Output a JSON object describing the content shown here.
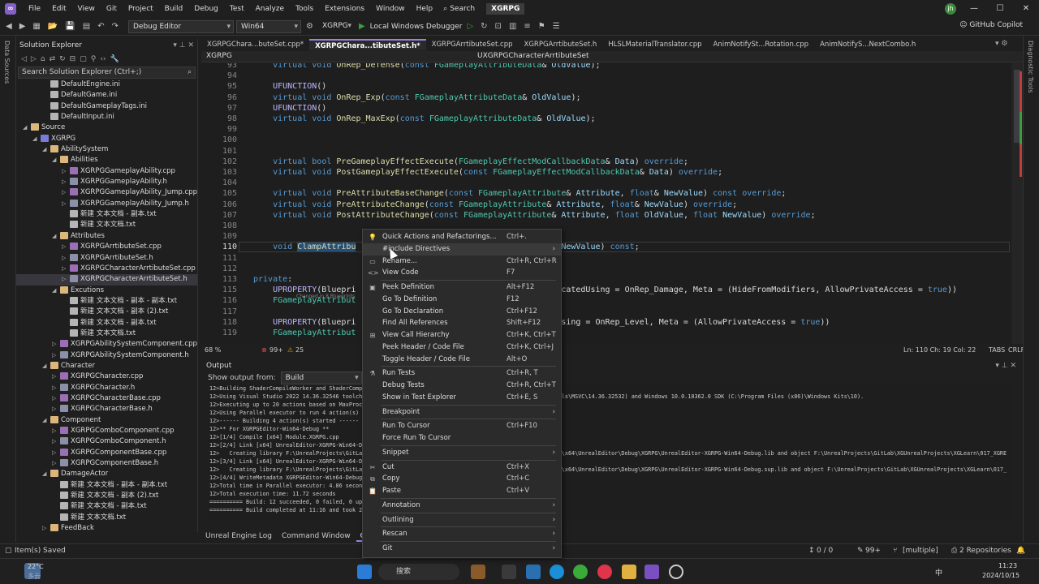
{
  "menu": [
    "File",
    "Edit",
    "View",
    "Git",
    "Project",
    "Build",
    "Debug",
    "Test",
    "Analyze",
    "Tools",
    "Extensions",
    "Window",
    "Help"
  ],
  "search_label": "Search",
  "solution_name": "XGRPG",
  "avatar_text": "jh",
  "window_controls": [
    "—",
    "☐",
    "✕"
  ],
  "toolbar": {
    "config": "Debug Editor",
    "platform": "Win64",
    "startup": "XGRPG",
    "debugger": "Local Windows Debugger",
    "copilot": "GitHub Copilot"
  },
  "left_strip": [
    "Data Sources"
  ],
  "right_strip": [
    "Diagnostic Tools"
  ],
  "solution_explorer": {
    "title": "Solution Explorer",
    "search_placeholder": "Search Solution Explorer (Ctrl+;)",
    "items": [
      {
        "label": "DefaultEngine.ini",
        "indent": 3,
        "type": "ini",
        "exp": ""
      },
      {
        "label": "DefaultGame.ini",
        "indent": 3,
        "type": "ini",
        "exp": ""
      },
      {
        "label": "DefaultGameplayTags.ini",
        "indent": 3,
        "type": "ini",
        "exp": ""
      },
      {
        "label": "DefaultInput.ini",
        "indent": 3,
        "type": "ini",
        "exp": ""
      },
      {
        "label": "Source",
        "indent": 1,
        "type": "folder",
        "exp": "◢"
      },
      {
        "label": "XGRPG",
        "indent": 2,
        "type": "proj",
        "exp": "◢"
      },
      {
        "label": "AbilitySystem",
        "indent": 3,
        "type": "folder",
        "exp": "◢"
      },
      {
        "label": "Abilities",
        "indent": 4,
        "type": "folder",
        "exp": "◢"
      },
      {
        "label": "XGRPGGameplayAbility.cpp",
        "indent": 5,
        "type": "cpp",
        "exp": "▷"
      },
      {
        "label": "XGRPGGameplayAbility.h",
        "indent": 5,
        "type": "h",
        "exp": "▷"
      },
      {
        "label": "XGRPGGameplayAbility_Jump.cpp",
        "indent": 5,
        "type": "cpp",
        "exp": "▷"
      },
      {
        "label": "XGRPGGameplayAbility_Jump.h",
        "indent": 5,
        "type": "h",
        "exp": "▷"
      },
      {
        "label": "新建 文本文档 - 副本.txt",
        "indent": 5,
        "type": "txt",
        "exp": ""
      },
      {
        "label": "新建 文本文档.txt",
        "indent": 5,
        "type": "txt",
        "exp": ""
      },
      {
        "label": "Attributes",
        "indent": 4,
        "type": "folder",
        "exp": "◢"
      },
      {
        "label": "XGRPGArrtibuteSet.cpp",
        "indent": 5,
        "type": "cpp",
        "exp": "▷"
      },
      {
        "label": "XGRPGArrtibuteSet.h",
        "indent": 5,
        "type": "h",
        "exp": "▷"
      },
      {
        "label": "XGRPGCharacterArrtibuteSet.cpp",
        "indent": 5,
        "type": "cpp",
        "exp": "▷"
      },
      {
        "label": "XGRPGCharacterArrtibuteSet.h",
        "indent": 5,
        "type": "h",
        "exp": "▷",
        "sel": true
      },
      {
        "label": "Excutions",
        "indent": 4,
        "type": "folder",
        "exp": "◢"
      },
      {
        "label": "新建 文本文档 - 副本 - 副本.txt",
        "indent": 5,
        "type": "txt",
        "exp": ""
      },
      {
        "label": "新建 文本文档 - 副本 (2).txt",
        "indent": 5,
        "type": "txt",
        "exp": ""
      },
      {
        "label": "新建 文本文档 - 副本.txt",
        "indent": 5,
        "type": "txt",
        "exp": ""
      },
      {
        "label": "新建 文本文档.txt",
        "indent": 5,
        "type": "txt",
        "exp": ""
      },
      {
        "label": "XGRPGAbilitySystemComponent.cpp",
        "indent": 4,
        "type": "cpp",
        "exp": "▷"
      },
      {
        "label": "XGRPGAbilitySystemComponent.h",
        "indent": 4,
        "type": "h",
        "exp": "▷"
      },
      {
        "label": "Character",
        "indent": 3,
        "type": "folder",
        "exp": "◢"
      },
      {
        "label": "XGRPGCharacter.cpp",
        "indent": 4,
        "type": "cpp",
        "exp": "▷"
      },
      {
        "label": "XGRPGCharacter.h",
        "indent": 4,
        "type": "h",
        "exp": "▷"
      },
      {
        "label": "XGRPGCharacterBase.cpp",
        "indent": 4,
        "type": "cpp",
        "exp": "▷"
      },
      {
        "label": "XGRPGCharacterBase.h",
        "indent": 4,
        "type": "h",
        "exp": "▷"
      },
      {
        "label": "Component",
        "indent": 3,
        "type": "folder",
        "exp": "◢"
      },
      {
        "label": "XGRPGComboComponent.cpp",
        "indent": 4,
        "type": "cpp",
        "exp": "▷"
      },
      {
        "label": "XGRPGComboComponent.h",
        "indent": 4,
        "type": "h",
        "exp": "▷"
      },
      {
        "label": "XGRPGComponentBase.cpp",
        "indent": 4,
        "type": "cpp",
        "exp": "▷"
      },
      {
        "label": "XGRPGComponentBase.h",
        "indent": 4,
        "type": "h",
        "exp": "▷"
      },
      {
        "label": "DamageActor",
        "indent": 3,
        "type": "folder",
        "exp": "◢"
      },
      {
        "label": "新建 文本文档 - 副本 - 副本.txt",
        "indent": 4,
        "type": "txt",
        "exp": ""
      },
      {
        "label": "新建 文本文档 - 副本 (2).txt",
        "indent": 4,
        "type": "txt",
        "exp": ""
      },
      {
        "label": "新建 文本文档 - 副本.txt",
        "indent": 4,
        "type": "txt",
        "exp": ""
      },
      {
        "label": "新建 文本文档.txt",
        "indent": 4,
        "type": "txt",
        "exp": ""
      },
      {
        "label": "FeedBack",
        "indent": 3,
        "type": "folder",
        "exp": "▷"
      }
    ]
  },
  "tabs": [
    {
      "label": "XGRPGChara...buteSet.cpp*",
      "active": false
    },
    {
      "label": "XGRPGChara...tibuteSet.h*",
      "active": true
    },
    {
      "label": "XGRPGArrtibuteSet.cpp",
      "active": false
    },
    {
      "label": "XGRPGArrtibuteSet.h",
      "active": false
    },
    {
      "label": "HLSLMaterialTranslator.cpp",
      "active": false
    },
    {
      "label": "AnimNotifySt...Rotation.cpp",
      "active": false
    },
    {
      "label": "AnimNotifyS...NextCombo.h",
      "active": false
    }
  ],
  "navbar": {
    "project": "XGRPG",
    "scope": "UXGRPGCharacterArrtibuteSet"
  },
  "code_lines": [
    {
      "n": "93",
      "html": "    <span class='kw'>virtual</span> <span class='kw'>void</span> <span class='fn'>OnRep_Defense</span>(<span class='kw'>const</span> <span class='ty'>FGameplayAttributeData</span>&amp; <span class='prm'>OldValue</span>);"
    },
    {
      "n": "94",
      "html": ""
    },
    {
      "n": "95",
      "html": "    <span class='mc'>UFUNCTION</span>()"
    },
    {
      "n": "96",
      "html": "    <span class='kw'>virtual</span> <span class='kw'>void</span> <span class='fn'>OnRep_Exp</span>(<span class='kw'>const</span> <span class='ty'>FGameplayAttributeData</span>&amp; <span class='prm'>OldValue</span>);"
    },
    {
      "n": "97",
      "html": "    <span class='mc'>UFUNCTION</span>()"
    },
    {
      "n": "98",
      "html": "    <span class='kw'>virtual</span> <span class='kw'>void</span> <span class='fn'>OnRep_MaxExp</span>(<span class='kw'>const</span> <span class='ty'>FGameplayAttributeData</span>&amp; <span class='prm'>OldValue</span>);"
    },
    {
      "n": "99",
      "html": ""
    },
    {
      "n": "100",
      "html": ""
    },
    {
      "n": "101",
      "html": ""
    },
    {
      "n": "102",
      "html": "    <span class='kw'>virtual</span> <span class='kw'>bool</span> <span class='fn'>PreGameplayEffectExecute</span>(<span class='ty'>FGameplayEffectModCallbackData</span>&amp; <span class='prm'>Data</span>) <span class='kw'>override</span>;"
    },
    {
      "n": "103",
      "html": "    <span class='kw'>virtual</span> <span class='kw'>void</span> <span class='fn'>PostGameplayEffectExecute</span>(<span class='kw'>const</span> <span class='ty'>FGameplayEffectModCallbackData</span>&amp; <span class='prm'>Data</span>) <span class='kw'>override</span>;"
    },
    {
      "n": "104",
      "html": ""
    },
    {
      "n": "105",
      "html": "    <span class='kw'>virtual</span> <span class='kw'>void</span> <span class='fn'>PreAttributeBaseChange</span>(<span class='kw'>const</span> <span class='ty'>FGameplayAttribute</span>&amp; <span class='prm'>Attribute</span>, <span class='kw'>float</span>&amp; <span class='prm'>NewValue</span>) <span class='kw'>const</span> <span class='kw'>override</span>;"
    },
    {
      "n": "106",
      "html": "    <span class='kw'>virtual</span> <span class='kw'>void</span> <span class='fn'>PreAttributeChange</span>(<span class='kw'>const</span> <span class='ty'>FGameplayAttribute</span>&amp; <span class='prm'>Attribute</span>, <span class='kw'>float</span>&amp; <span class='prm'>NewValue</span>) <span class='kw'>override</span>;"
    },
    {
      "n": "107",
      "html": "    <span class='kw'>virtual</span> <span class='kw'>void</span> <span class='fn'>PostAttributeChange</span>(<span class='kw'>const</span> <span class='ty'>FGameplayAttribute</span>&amp; <span class='prm'>Attribute</span>, <span class='kw'>float</span> <span class='prm'>OldValue</span>, <span class='kw'>float</span> <span class='prm'>NewValue</span>) <span class='kw'>override</span>;"
    },
    {
      "n": "108",
      "html": ""
    },
    {
      "n": "109",
      "html": ""
    },
    {
      "n": "110",
      "html": "    <span class='kw'>void</span> <span class='fn hl'>ClampAttribu</span>                                 , <span class='kw'>float</span>&amp; <span class='prm'>NewValue</span>) <span class='kw'>const</span>;",
      "cur": true
    },
    {
      "n": "111",
      "html": ""
    },
    {
      "n": "112",
      "html": ""
    },
    {
      "n": "113",
      "html": "<span class='kw'>private</span>:"
    },
    {
      "n": "115",
      "html": "    <span class='mc'>UPROPERTY</span>(Bluepri                                 <span class='str'>e\"</span>, ReplicatedUsing = OnRep_Damage, Meta = (HideFromModifiers, AllowPrivateAccess = <span class='kw'>true</span>))"
    },
    {
      "n": "116",
      "html": "    <span class='ty'>FGameplayAttribut</span>"
    },
    {
      "n": "117",
      "html": ""
    },
    {
      "n": "118",
      "html": "    <span class='mc'>UPROPERTY</span>(Bluepri                                 plicatedUsing = OnRep_Level, Meta = (AllowPrivateAccess = <span class='kw'>true</span>))"
    },
    {
      "n": "119",
      "html": "    <span class='ty'>FGameplayAttribut</span>"
    }
  ],
  "inline_hint": "Changed in 8 Blueprints",
  "editor_status": {
    "zoom": "68 %",
    "errors": "99+",
    "warnings": "25",
    "position": "Ln: 110   Ch: 19   Col: 22",
    "tabs": "TABS",
    "eol": "CRLF"
  },
  "output": {
    "title": "Output",
    "show_from_label": "Show output from:",
    "source": "Build",
    "lines": [
      "12>Building ShaderCompileWorker and ShaderCompileWorker",
      "12>Using Visual Studio 2022 14.36.32546 toolcha                                                      C\\Tools\\MSVC\\14.36.32532) and Windows 10.0.18362.0 SDK (C:\\Program Files (x86)\\Windows Kits\\10).",
      "12>Executing up to 20 actions based on MaxProce",
      "12>Using Parallel executor to run 4 action(s)",
      "12>------ Building 4 action(s) started ------",
      "12>** For XGRPGEditor-Win64-Debug **",
      "12>[1/4] Compile [x64] Module.XGRPG.cpp",
      "12>[2/4] Link [x64] UnrealEditor-XGRPG-Win64-De",
      "12>   Creating library F:\\UnrealProjects\\GitLab                                                      Win64\\x64\\UnrealEditor\\Debug\\XGRPG\\UnrealEditor-XGRPG-Win64-Debug.lib and object F:\\UnrealProjects\\GitLab\\XGUnrealProjects\\XGLearn\\017_XGRE",
      "12>[3/4] Link [x64] UnrealEditor-XGRPG-Win64-De",
      "12>   Creating library F:\\UnrealProjects\\GitLab                                                      Win64\\x64\\UnrealEditor\\Debug\\XGRPG\\UnrealEditor-XGRPG-Win64-Debug.sup.lib and object F:\\UnrealProjects\\GitLab\\XGUnrealProjects\\XGLearn\\017_",
      "12>[4/4] WriteMetadata XGRPGEditor-Win64-Debug.",
      "12>Total time in Parallel executor: 4.86 second",
      "12>Total execution time: 11.72 seconds",
      "========== Build: 12 succeeded, 0 failed, 0 up-",
      "========== Build completed at 11:16 and took 20"
    ]
  },
  "bottom_tabs": [
    {
      "label": "Unreal Engine Log",
      "active": false
    },
    {
      "label": "Command Window",
      "active": false
    },
    {
      "label": "Output",
      "active": true
    }
  ],
  "statusbar": {
    "left": "Item(s) Saved",
    "changes": "0 / 0",
    "errors": "99+",
    "branch": "[multiple]",
    "repos": "2 Repositories"
  },
  "taskbar": {
    "weather_temp": "22°C",
    "weather_desc": "多云",
    "search": "搜索",
    "lang": "中",
    "time": "11:23",
    "date": "2024/10/15"
  },
  "context_menu": [
    {
      "label": "Quick Actions and Refactorings...",
      "shortcut": "Ctrl+.",
      "icon": "💡"
    },
    {
      "label": "#include Directives",
      "shortcut": "",
      "arrow": true,
      "hot": true
    },
    {
      "label": "Rename...",
      "shortcut": "Ctrl+R, Ctrl+R",
      "icon": "▭"
    },
    {
      "label": "View Code",
      "shortcut": "F7",
      "icon": "<>"
    },
    {
      "sep": true
    },
    {
      "label": "Peek Definition",
      "shortcut": "Alt+F12",
      "icon": "▣"
    },
    {
      "label": "Go To Definition",
      "shortcut": "F12"
    },
    {
      "label": "Go To Declaration",
      "shortcut": "Ctrl+F12"
    },
    {
      "label": "Find All References",
      "shortcut": "Shift+F12"
    },
    {
      "label": "View Call Hierarchy",
      "shortcut": "Ctrl+K, Ctrl+T",
      "icon": "⊞"
    },
    {
      "label": "Peek Header / Code File",
      "shortcut": "Ctrl+K, Ctrl+J"
    },
    {
      "label": "Toggle Header / Code File",
      "shortcut": "Alt+O"
    },
    {
      "sep": true
    },
    {
      "label": "Run Tests",
      "shortcut": "Ctrl+R, T",
      "icon": "⚗"
    },
    {
      "label": "Debug Tests",
      "shortcut": "Ctrl+R, Ctrl+T"
    },
    {
      "label": "Show in Test Explorer",
      "shortcut": "Ctrl+E, S"
    },
    {
      "sep": true
    },
    {
      "label": "Breakpoint",
      "shortcut": "",
      "arrow": true
    },
    {
      "sep": true
    },
    {
      "label": "Run To Cursor",
      "shortcut": "Ctrl+F10"
    },
    {
      "label": "Force Run To Cursor",
      "shortcut": ""
    },
    {
      "sep": true
    },
    {
      "label": "Snippet",
      "shortcut": "",
      "arrow": true
    },
    {
      "sep": true
    },
    {
      "label": "Cut",
      "shortcut": "Ctrl+X",
      "icon": "✂"
    },
    {
      "label": "Copy",
      "shortcut": "Ctrl+C",
      "icon": "⧉"
    },
    {
      "label": "Paste",
      "shortcut": "Ctrl+V",
      "icon": "📋"
    },
    {
      "sep": true
    },
    {
      "label": "Annotation",
      "shortcut": "",
      "arrow": true
    },
    {
      "sep": true
    },
    {
      "label": "Outlining",
      "shortcut": "",
      "arrow": true
    },
    {
      "sep": true
    },
    {
      "label": "Rescan",
      "shortcut": "",
      "arrow": true
    },
    {
      "sep": true
    },
    {
      "label": "Git",
      "shortcut": "",
      "arrow": true
    }
  ]
}
